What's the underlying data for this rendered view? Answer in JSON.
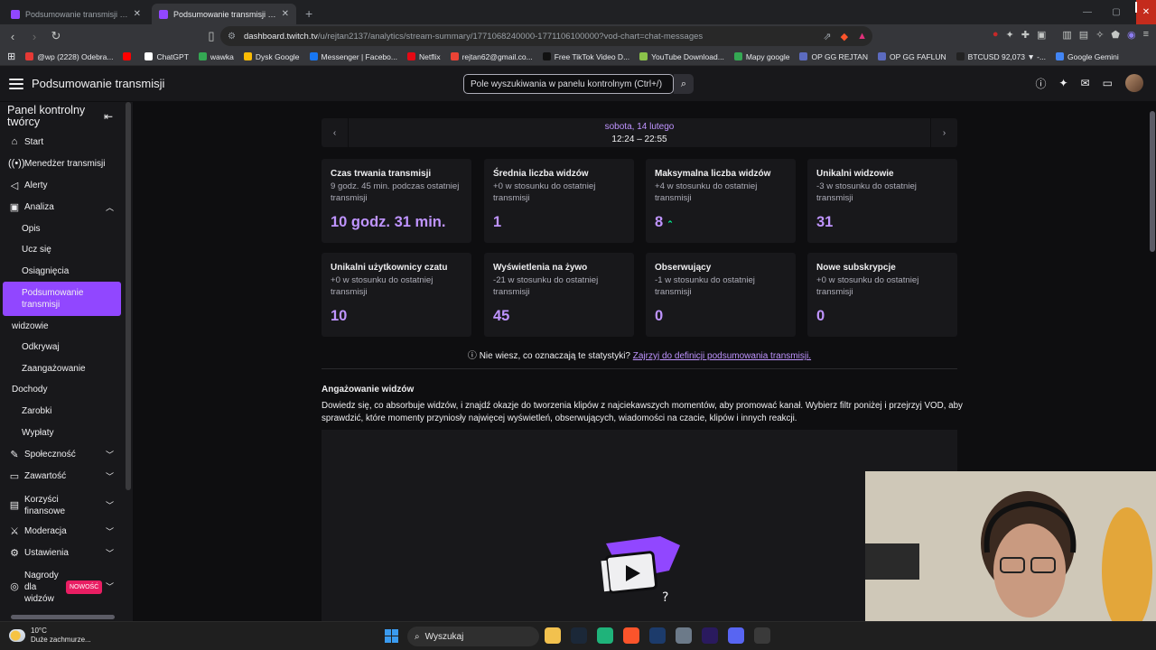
{
  "browser": {
    "tabs": [
      {
        "title": "Podsumowanie transmisji jest gotowe",
        "active": false,
        "color": "#9147ff"
      },
      {
        "title": "Podsumowanie transmisji - Twitch",
        "active": true,
        "color": "#9147ff"
      }
    ],
    "url_host": "dashboard.twitch.tv",
    "url_path": "/u/rejtan2137/analytics/stream-summary/1771068240000-1771106100000?vod-chart=chat-messages",
    "bookmarks": [
      {
        "label": "@wp (2228) Odebra...",
        "color": "#e53935"
      },
      {
        "label": "",
        "color": "#ff0000"
      },
      {
        "label": "ChatGPT",
        "color": "#ffffff"
      },
      {
        "label": "wawka",
        "color": "#34a853"
      },
      {
        "label": "Dysk Google",
        "color": "#fbbc04"
      },
      {
        "label": "Messenger | Facebo...",
        "color": "#1877f2"
      },
      {
        "label": "Netflix",
        "color": "#e50914"
      },
      {
        "label": "rejtan62@gmail.co...",
        "color": "#ea4335"
      },
      {
        "label": "Free TikTok Video D...",
        "color": "#111111"
      },
      {
        "label": "YouTube Download...",
        "color": "#8bc34a"
      },
      {
        "label": "Mapy google",
        "color": "#34a853"
      },
      {
        "label": "OP GG REJTAN",
        "color": "#5c6bc0"
      },
      {
        "label": "OP GG FAFLUN",
        "color": "#5c6bc0"
      },
      {
        "label": "BTCUSD 92,073 ▼ -...",
        "color": "#222222"
      },
      {
        "label": "Google Gemini",
        "color": "#4285f4"
      }
    ]
  },
  "header": {
    "title": "Podsumowanie transmisji",
    "search_placeholder": "Pole wyszukiwania w panelu kontrolnym (Ctrl+/)"
  },
  "sidebar": {
    "heading": "Panel kontrolny twórcy",
    "items": [
      {
        "label": "Start",
        "icon": "home-icon"
      },
      {
        "label": "Menedżer transmisji",
        "icon": "broadcast-icon"
      },
      {
        "label": "Alerty",
        "icon": "megaphone-icon"
      },
      {
        "label": "Analiza",
        "icon": "analytics-icon"
      },
      {
        "label": "Opis"
      },
      {
        "label": "Ucz się"
      },
      {
        "label": "Osiągnięcia"
      },
      {
        "label": "Podsumowanie transmisji"
      },
      {
        "label": "widzowie"
      },
      {
        "label": "Odkrywaj"
      },
      {
        "label": "Zaangażowanie"
      },
      {
        "label": "Dochody"
      },
      {
        "label": "Zarobki"
      },
      {
        "label": "Wypłaty"
      },
      {
        "label": "Społeczność",
        "icon": "community-icon"
      },
      {
        "label": "Zawartość",
        "icon": "content-icon"
      },
      {
        "label": "Korzyści finansowe",
        "icon": "money-icon"
      },
      {
        "label": "Moderacja",
        "icon": "sword-icon"
      },
      {
        "label": "Ustawienia",
        "icon": "gear-icon"
      },
      {
        "label": "Nagrody dla widzów",
        "icon": "reward-icon"
      }
    ],
    "badge": "NOWOŚĆ"
  },
  "summary": {
    "day": "sobota, 14 lutego",
    "time": "12:24 – 22:55",
    "cards": [
      {
        "title": "Czas trwania transmisji",
        "sub": "9 godz. 45 min. podczas ostatniej transmisji",
        "value": "10 godz. 31 min."
      },
      {
        "title": "Średnia liczba widzów",
        "sub": "+0 w stosunku do ostatniej transmisji",
        "value": "1"
      },
      {
        "title": "Maksymalna liczba widzów",
        "sub": "+4 w stosunku do ostatniej transmisji",
        "value": "8"
      },
      {
        "title": "Unikalni widzowie",
        "sub": "-3 w stosunku do ostatniej transmisji",
        "value": "31"
      },
      {
        "title": "Unikalni użytkownicy czatu",
        "sub": "+0 w stosunku do ostatniej transmisji",
        "value": "10"
      },
      {
        "title": "Wyświetlenia na żywo",
        "sub": "-21 w stosunku do ostatniej transmisji",
        "value": "45"
      },
      {
        "title": "Obserwujący",
        "sub": "-1 w stosunku do ostatniej transmisji",
        "value": "0"
      },
      {
        "title": "Nowe subskrypcje",
        "sub": "+0 w stosunku do ostatniej transmisji",
        "value": "0"
      }
    ],
    "help_text": "Nie wiesz, co oznaczają te statystyki?",
    "help_link": "Zajrzyj do definicji podsumowania transmisji."
  },
  "engagement": {
    "title": "Angażowanie widzów",
    "description": "Dowiedz się, co absorbuje widzów, i znajdź okazje do tworzenia klipów z najciekawszych momentów, aby promować kanał. Wybierz filtr poniżej i przejrzyj VOD, aby sprawdzić, które momenty przyniosły najwięcej wyświetleń, obserwujących, wiadomości na czacie, klipów i innych reakcji."
  },
  "taskbar": {
    "temp": "10°C",
    "weather": "Duże zachmurze...",
    "search": "Wyszukaj"
  },
  "colors": {
    "accent": "#9147ff",
    "accent_text": "#bf94ff"
  }
}
